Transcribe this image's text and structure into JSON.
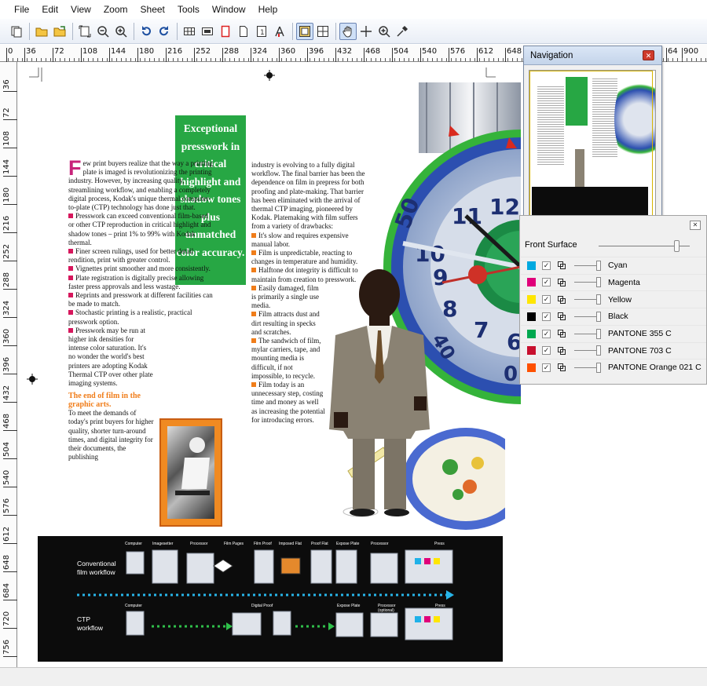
{
  "menu": [
    "File",
    "Edit",
    "View",
    "Zoom",
    "Sheet",
    "Tools",
    "Window",
    "Help"
  ],
  "toolbar": {
    "icons": [
      "select-page-icon",
      "open-file-icon",
      "open-folder-icon",
      "fit-page-icon",
      "zoom-out-icon",
      "zoom-in-icon",
      "rotate-ccw-icon",
      "rotate-cw-icon",
      "grid-icon",
      "preview-icon",
      "trim-box-icon",
      "page-icon",
      "page-number-icon",
      "text-cursor-icon",
      "single-view-icon",
      "split-view-icon",
      "hand-tool-icon",
      "crosshair-icon",
      "magnifier-icon",
      "eyedropper-icon"
    ]
  },
  "ruler": {
    "h": [
      "0",
      "36",
      "72",
      "108",
      "144",
      "180",
      "216",
      "252",
      "288",
      "324",
      "360",
      "396",
      "432",
      "468",
      "504",
      "540",
      "576",
      "612",
      "648",
      "64",
      "900"
    ],
    "v": [
      "36",
      "72",
      "108",
      "144",
      "180",
      "216",
      "252",
      "288",
      "324",
      "360",
      "396",
      "432",
      "468",
      "504",
      "540",
      "576",
      "612",
      "648",
      "684",
      "720",
      "756",
      "792"
    ]
  },
  "document": {
    "headline": "Exceptional presswork in critical highlight and shadow tones plus unmatched color accuracy.",
    "dropcap": "F",
    "col1_intro": "ew print buyers realize that the way a printing plate is imaged is revolutionizing the printing industry. However, by increasing quality, streamlining workflow, and enabling a completely digital process, Kodak's unique thermal computer-to-plate (CTP) technology has done just that.",
    "col1_bullets": [
      "Presswork can exceed conventional film-based or other CTP reproduction in critical highlight and shadow tones – print 1% to 99% with Kodak thermal.",
      "Finer screen rulings, used for better detail rendition, print with greater control.",
      "Vignettes print smoother and more consistently.",
      "Plate registration is digitally precise allowing faster press approvals and less wastage.",
      "Reprints and presswork at different facilities can be made to match.",
      "Stochastic printing is a realistic, practical presswork option.",
      "Presswork may be run at higher ink densities for intense color saturation. It's no wonder the world's best printers are adopting Kodak Thermal CTP over other plate imaging systems."
    ],
    "subhead": "The end of film in the graphic arts.",
    "col1_end": "To meet the demands of today's print buyers for higher quality, shorter turn-around times, and digital integrity for their documents, the publishing",
    "col2_top": "industry is evolving to a fully digital workflow. The final barrier has been the dependence on film in prepress for both proofing and plate-making. That barrier has been eliminated with the arrival of thermal CTP imaging, pioneered by Kodak. Platemaking with film suffers from a variety of drawbacks:",
    "col2_bullets": [
      "It's slow and requires expensive manual labor.",
      "Film is unpredictable, reacting to changes in temperature and humidity.",
      "Halftone dot integrity is difficult to maintain from creation to presswork.",
      "Easily damaged, film is primarily a single use media.",
      "Film attracts dust and dirt resulting in specks and scratches.",
      "The sandwich of film, mylar carriers, tape, and mounting media is difficult, if not impossible, to recycle.",
      "Film today is an unnecessary step, costing time and money as well as increasing the potential for introducing errors."
    ],
    "watch_numbers": [
      "50",
      "11",
      "12",
      "10",
      "9",
      "8",
      "7",
      "6",
      "40",
      "0"
    ],
    "workflow": {
      "conventional_label": "Conventional film workflow",
      "ctp_label": "CTP workflow",
      "top_labels": [
        "Computer",
        "Imagesetter",
        "Processor",
        "Film Pages",
        "Film Proof",
        "Imposed Flat",
        "Proof Flat",
        "Expose Plate",
        "Processor",
        "Press"
      ],
      "bottom_labels": [
        "Computer",
        "Digital Proof",
        "Expose Plate",
        "Processor",
        "(optional)",
        "Press"
      ]
    }
  },
  "navigation": {
    "title": "Navigation"
  },
  "separations": {
    "front_surface": "Front Surface",
    "plates": [
      {
        "name": "Cyan",
        "color": "#00a9e0"
      },
      {
        "name": "Magenta",
        "color": "#e0007a"
      },
      {
        "name": "Yellow",
        "color": "#ffe600"
      },
      {
        "name": "Black",
        "color": "#000000"
      },
      {
        "name": "PANTONE 355 C",
        "color": "#00a84f"
      },
      {
        "name": "PANTONE 703 C",
        "color": "#c8102e"
      },
      {
        "name": "PANTONE Orange 021 C",
        "color": "#fe5000"
      }
    ]
  },
  "colors": {
    "headline_bg": "#27a744",
    "dropcap": "#c8247a",
    "subhead": "#f07d1a",
    "bullet_col1": "#d6175c",
    "bullet_col2": "#f07d1a",
    "toolbar_bg": "#e9eef6"
  }
}
